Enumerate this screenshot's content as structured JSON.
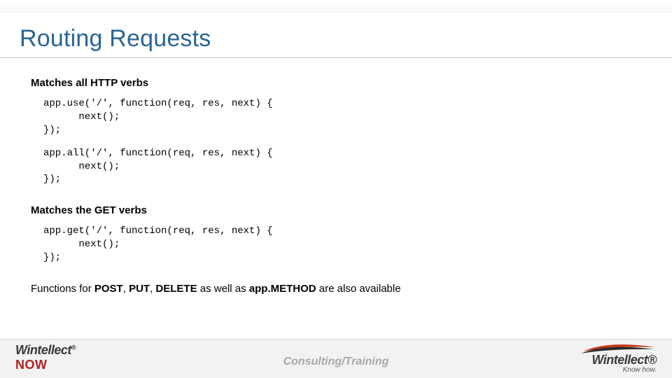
{
  "title": "Routing Requests",
  "section1": "Matches all HTTP verbs",
  "code1": "app.use('/', function(req, res, next) {\n      next();\n});",
  "code2": "app.all('/', function(req, res, next) {\n      next();\n});",
  "section2": "Matches the GET verbs",
  "code3": "app.get('/', function(req, res, next) {\n      next();\n});",
  "note_pre": "Functions for ",
  "note_b1": "POST",
  "note_c1": ", ",
  "note_b2": "PUT",
  "note_c2": ", ",
  "note_b3": "DELETE",
  "note_mid": " as well as ",
  "note_b4": "app.METHOD",
  "note_post": " are also available",
  "footer_center": "Consulting/Training",
  "logo_left_brand": "Wintellect",
  "logo_left_now": "NOW",
  "logo_left_reg": "®",
  "logo_right_brand": "Wintellect",
  "logo_right_reg": "®",
  "logo_right_tag": "Know how."
}
